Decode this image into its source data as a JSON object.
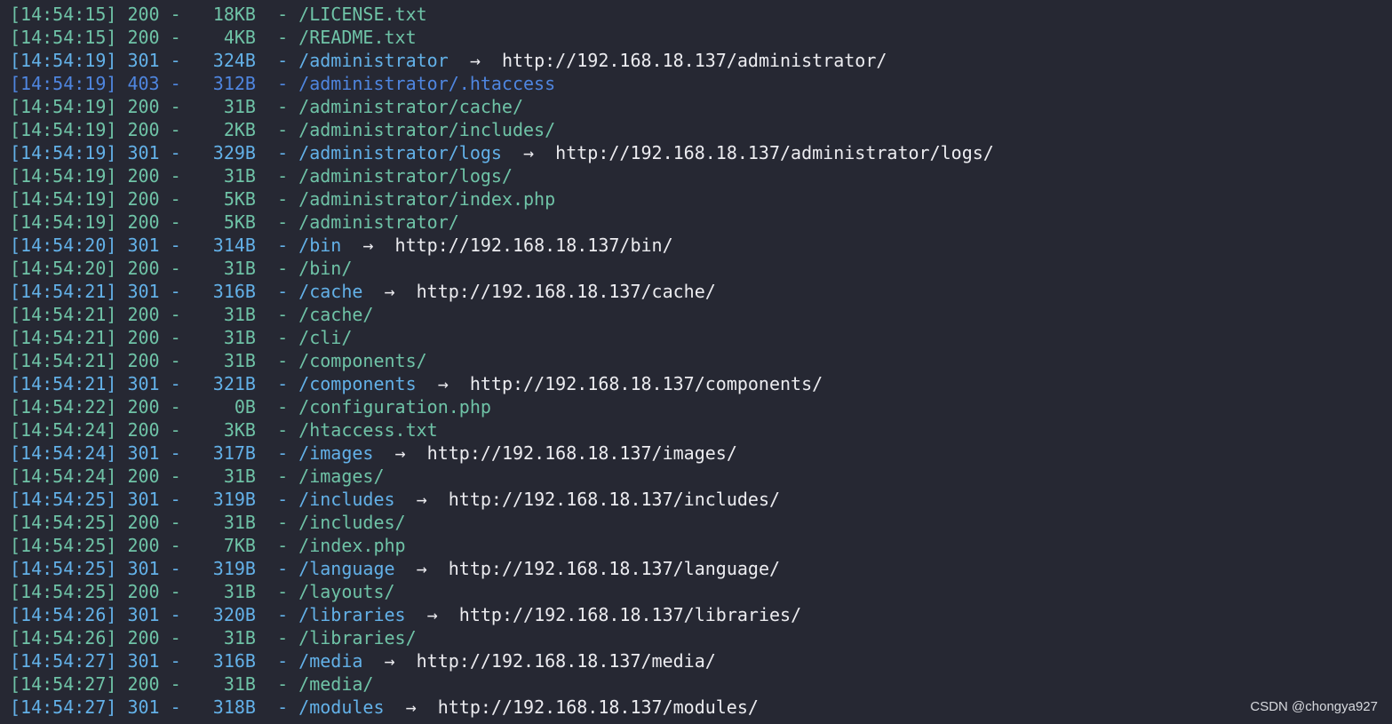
{
  "colors": {
    "background": "#262833",
    "ok": "#6fc3a7",
    "redirect": "#63b1e8",
    "forbidden": "#4f86e0",
    "url": "#ececf0"
  },
  "terminal": {
    "lines": [
      {
        "time": "[14:54:15]",
        "code": "200",
        "size": "18KB",
        "path": "/LICENSE.txt",
        "redirect": ""
      },
      {
        "time": "[14:54:15]",
        "code": "200",
        "size": "4KB",
        "path": "/README.txt",
        "redirect": ""
      },
      {
        "time": "[14:54:19]",
        "code": "301",
        "size": "324B",
        "path": "/administrator",
        "redirect": "http://192.168.18.137/administrator/"
      },
      {
        "time": "[14:54:19]",
        "code": "403",
        "size": "312B",
        "path": "/administrator/.htaccess",
        "redirect": ""
      },
      {
        "time": "[14:54:19]",
        "code": "200",
        "size": "31B",
        "path": "/administrator/cache/",
        "redirect": ""
      },
      {
        "time": "[14:54:19]",
        "code": "200",
        "size": "2KB",
        "path": "/administrator/includes/",
        "redirect": ""
      },
      {
        "time": "[14:54:19]",
        "code": "301",
        "size": "329B",
        "path": "/administrator/logs",
        "redirect": "http://192.168.18.137/administrator/logs/"
      },
      {
        "time": "[14:54:19]",
        "code": "200",
        "size": "31B",
        "path": "/administrator/logs/",
        "redirect": ""
      },
      {
        "time": "[14:54:19]",
        "code": "200",
        "size": "5KB",
        "path": "/administrator/index.php",
        "redirect": ""
      },
      {
        "time": "[14:54:19]",
        "code": "200",
        "size": "5KB",
        "path": "/administrator/",
        "redirect": ""
      },
      {
        "time": "[14:54:20]",
        "code": "301",
        "size": "314B",
        "path": "/bin",
        "redirect": "http://192.168.18.137/bin/"
      },
      {
        "time": "[14:54:20]",
        "code": "200",
        "size": "31B",
        "path": "/bin/",
        "redirect": ""
      },
      {
        "time": "[14:54:21]",
        "code": "301",
        "size": "316B",
        "path": "/cache",
        "redirect": "http://192.168.18.137/cache/"
      },
      {
        "time": "[14:54:21]",
        "code": "200",
        "size": "31B",
        "path": "/cache/",
        "redirect": ""
      },
      {
        "time": "[14:54:21]",
        "code": "200",
        "size": "31B",
        "path": "/cli/",
        "redirect": ""
      },
      {
        "time": "[14:54:21]",
        "code": "200",
        "size": "31B",
        "path": "/components/",
        "redirect": ""
      },
      {
        "time": "[14:54:21]",
        "code": "301",
        "size": "321B",
        "path": "/components",
        "redirect": "http://192.168.18.137/components/"
      },
      {
        "time": "[14:54:22]",
        "code": "200",
        "size": "0B",
        "path": "/configuration.php",
        "redirect": ""
      },
      {
        "time": "[14:54:24]",
        "code": "200",
        "size": "3KB",
        "path": "/htaccess.txt",
        "redirect": ""
      },
      {
        "time": "[14:54:24]",
        "code": "301",
        "size": "317B",
        "path": "/images",
        "redirect": "http://192.168.18.137/images/"
      },
      {
        "time": "[14:54:24]",
        "code": "200",
        "size": "31B",
        "path": "/images/",
        "redirect": ""
      },
      {
        "time": "[14:54:25]",
        "code": "301",
        "size": "319B",
        "path": "/includes",
        "redirect": "http://192.168.18.137/includes/"
      },
      {
        "time": "[14:54:25]",
        "code": "200",
        "size": "31B",
        "path": "/includes/",
        "redirect": ""
      },
      {
        "time": "[14:54:25]",
        "code": "200",
        "size": "7KB",
        "path": "/index.php",
        "redirect": ""
      },
      {
        "time": "[14:54:25]",
        "code": "301",
        "size": "319B",
        "path": "/language",
        "redirect": "http://192.168.18.137/language/"
      },
      {
        "time": "[14:54:25]",
        "code": "200",
        "size": "31B",
        "path": "/layouts/",
        "redirect": ""
      },
      {
        "time": "[14:54:26]",
        "code": "301",
        "size": "320B",
        "path": "/libraries",
        "redirect": "http://192.168.18.137/libraries/"
      },
      {
        "time": "[14:54:26]",
        "code": "200",
        "size": "31B",
        "path": "/libraries/",
        "redirect": ""
      },
      {
        "time": "[14:54:27]",
        "code": "301",
        "size": "316B",
        "path": "/media",
        "redirect": "http://192.168.18.137/media/"
      },
      {
        "time": "[14:54:27]",
        "code": "200",
        "size": "31B",
        "path": "/media/",
        "redirect": ""
      },
      {
        "time": "[14:54:27]",
        "code": "301",
        "size": "318B",
        "path": "/modules",
        "redirect": "http://192.168.18.137/modules/"
      }
    ]
  },
  "watermark": "CSDN @chongya927"
}
